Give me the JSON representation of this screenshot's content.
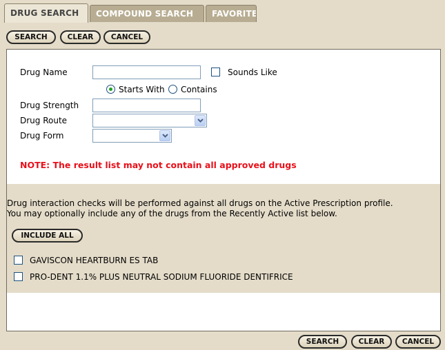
{
  "tabs": [
    {
      "label": "DRUG SEARCH",
      "active": true
    },
    {
      "label": "COMPOUND SEARCH",
      "active": false
    },
    {
      "label": "FAVORITES",
      "active": false
    }
  ],
  "toolbar_top": {
    "search": "SEARCH",
    "clear": "CLEAR",
    "cancel": "CANCEL"
  },
  "toolbar_bottom": {
    "search": "SEARCH",
    "clear": "CLEAR",
    "cancel": "CANCEL"
  },
  "form": {
    "drug_name_label": "Drug Name",
    "drug_name_value": "",
    "sounds_like_label": "Sounds Like",
    "sounds_like_checked": false,
    "starts_with_label": "Starts With",
    "contains_label": "Contains",
    "match_mode": "Starts With",
    "drug_strength_label": "Drug Strength",
    "drug_strength_value": "",
    "drug_route_label": "Drug Route",
    "drug_route_value": "",
    "drug_form_label": "Drug Form",
    "drug_form_value": ""
  },
  "note": "NOTE: The result list may not contain all approved drugs",
  "interaction": {
    "text_line1": "Drug interaction checks will be performed against all drugs on the Active Prescription profile.",
    "text_line2": "You may optionally include any of the drugs from the Recently Active list below.",
    "include_all_label": "INCLUDE ALL",
    "drugs": [
      {
        "name": "GAVISCON HEARTBURN ES TAB",
        "checked": false
      },
      {
        "name": "PRO-DENT 1.1% PLUS NEUTRAL SODIUM FLUORIDE DENTIFRICE",
        "checked": false
      }
    ]
  },
  "colors": {
    "background": "#e4dcc9",
    "note_red": "#e8101a",
    "radio_selected": "#21a121",
    "input_border": "#7f9db9"
  }
}
